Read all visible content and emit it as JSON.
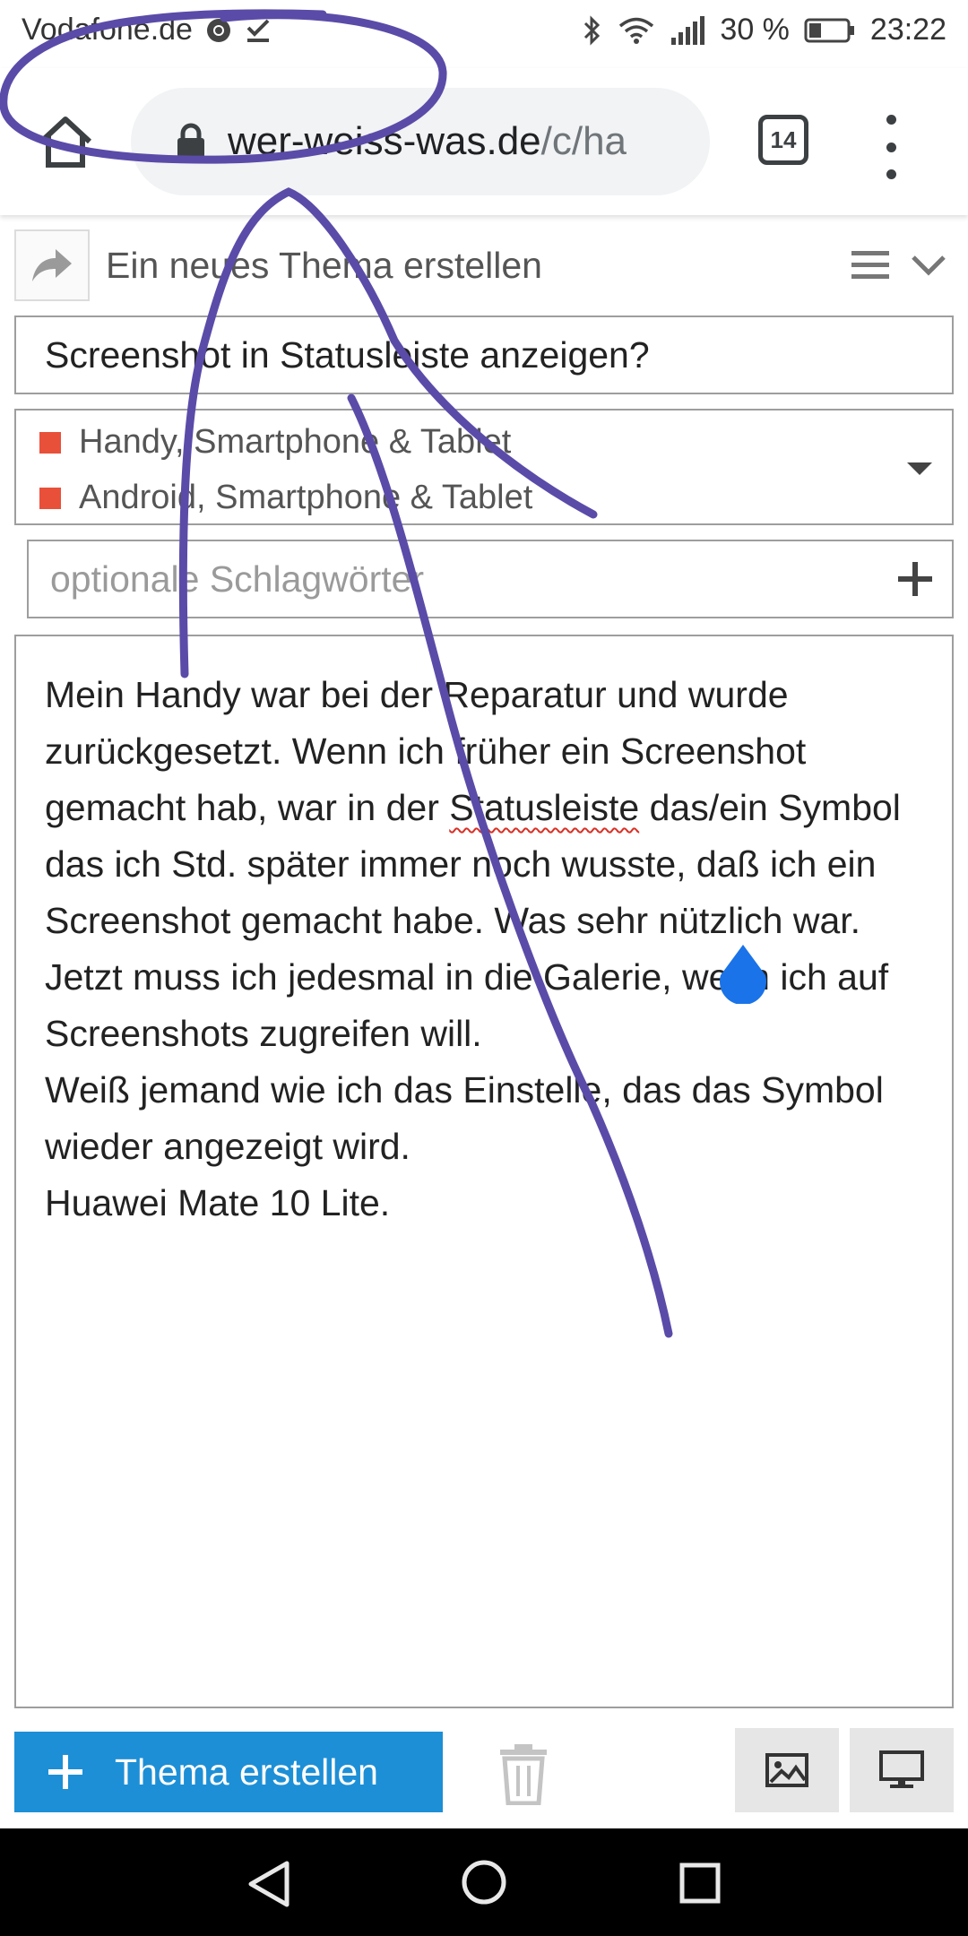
{
  "status_bar": {
    "carrier": "Vodafone.de",
    "battery": "30 %",
    "time": "23:22"
  },
  "browser": {
    "url_domain": "wer-weiss-was.de",
    "url_path": "/c/ha",
    "tab_count": "14"
  },
  "topic_header": {
    "title": "Ein neues Thema erstellen"
  },
  "form": {
    "title_value": "Screenshot in Statusleiste anzeigen?",
    "categories": [
      "Handy, Smartphone & Tablet",
      "Android, Smartphone & Tablet"
    ],
    "tags_placeholder": "optionale Schlagwörter",
    "body": {
      "line1": "Mein Handy war bei der Reparatur und wurde zurückgesetzt. Wenn ich früher ein Screenshot gemacht hab, war in der ",
      "spell_word": "Statusleiste",
      "line1_rest": " das/ein Symbol das ich Std. später immer noch wusste, daß ich ein Screenshot gemacht habe. Was sehr nützlich war. Jetzt muss ich jedesmal in die Galerie, wenn ich auf Screenshots zugreifen will.",
      "line2": "Weiß jemand wie ich das Einstelle, das das Symbol wieder angezeigt wird.",
      "line3": "Huawei Mate 10 Lite."
    }
  },
  "actions": {
    "create_label": "Thema erstellen"
  },
  "colors": {
    "category_swatch": "#e8503a",
    "create_button": "#1d8fd6",
    "annotation_stroke": "#5b4ba8",
    "cursor_handle": "#1a73e8"
  }
}
